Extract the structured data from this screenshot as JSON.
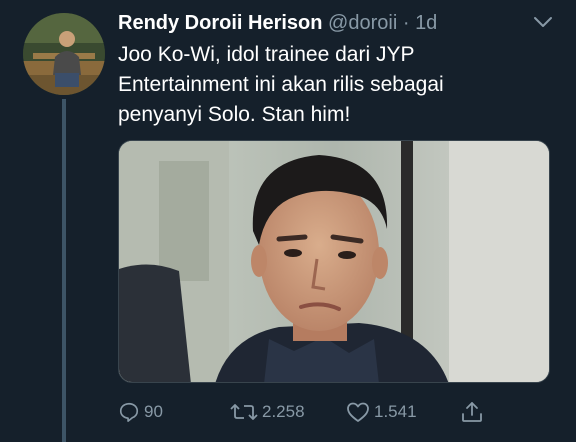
{
  "author": {
    "name": "Rendy Doroii Herison",
    "handle": "@doroii",
    "separator": "·",
    "time": "1d"
  },
  "tweet": {
    "lines": [
      "Joo Ko-Wi, idol trainee dari JYP",
      "Entertainment ini akan rilis sebagai",
      "penyanyi Solo. Stan him!"
    ]
  },
  "actions": {
    "replies": "90",
    "retweets": "2.258",
    "likes": "1.541"
  },
  "colors": {
    "background": "#15202b",
    "secondary_text": "#8899a6",
    "thread_line": "#3d5466"
  },
  "icons": [
    "chevron-down-icon",
    "reply-icon",
    "retweet-icon",
    "like-icon",
    "share-icon"
  ]
}
